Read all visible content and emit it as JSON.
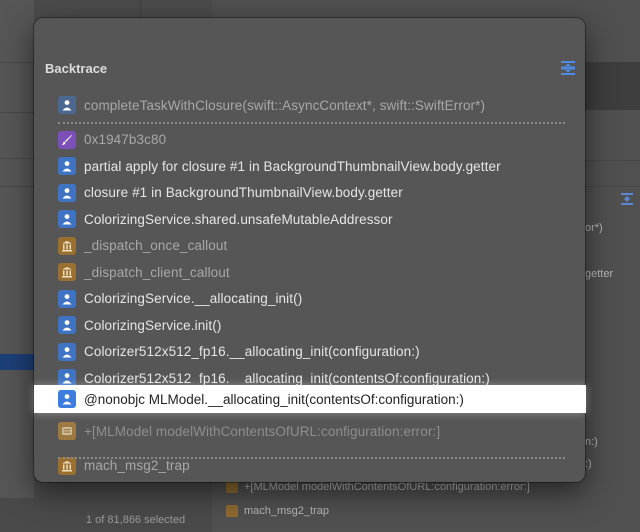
{
  "popover": {
    "title": "Backtrace",
    "collapse_icon": "collapse-icon"
  },
  "frames": [
    {
      "label": "completeTaskWithClosure(swift::AsyncContext*, swift::SwiftError*)",
      "icon": "user-code-icon",
      "style": "dim"
    },
    {
      "label": "0x1947b3c80",
      "icon": "brush-icon",
      "style": "dim"
    },
    {
      "label": "partial apply for closure #1 in BackgroundThumbnailView.body.getter",
      "icon": "user-code-icon",
      "style": "normal"
    },
    {
      "label": "closure #1 in BackgroundThumbnailView.body.getter",
      "icon": "user-code-icon",
      "style": "normal"
    },
    {
      "label": "ColorizingService.shared.unsafeMutableAddressor",
      "icon": "user-code-icon",
      "style": "normal"
    },
    {
      "label": "_dispatch_once_callout",
      "icon": "library-icon",
      "style": "dim"
    },
    {
      "label": "_dispatch_client_callout",
      "icon": "library-icon",
      "style": "dim"
    },
    {
      "label": "ColorizingService.__allocating_init()",
      "icon": "user-code-icon",
      "style": "normal"
    },
    {
      "label": "ColorizingService.init()",
      "icon": "user-code-icon",
      "style": "normal"
    },
    {
      "label": "Colorizer512x512_fp16.__allocating_init(configuration:)",
      "icon": "user-code-icon",
      "style": "normal"
    },
    {
      "label": "Colorizer512x512_fp16.__allocating_init(contentsOf:configuration:)",
      "icon": "user-code-icon",
      "style": "normal"
    },
    {
      "label": "@nonobjc MLModel.__allocating_init(contentsOf:configuration:)",
      "icon": "user-code-icon",
      "style": "selected"
    },
    {
      "label": "+[MLModel modelWithContentsOfURL:configuration:error:]",
      "icon": "library-icon",
      "style": "faint"
    },
    {
      "label": "mach_msg2_trap",
      "icon": "library-icon",
      "style": "dim"
    }
  ],
  "background": {
    "status": "1 of 81,866 selected",
    "right_texts": [
      "or*)",
      "getter",
      "n:)",
      ":)",
      "+[MLModel modelWithContentsOfURL:configuration:error:]",
      "mach_msg2_trap"
    ]
  },
  "colors": {
    "user_code": "#3f73c4",
    "library": "#9a7030",
    "brush": "#7d4fb8",
    "highlight": "#ffffff"
  }
}
